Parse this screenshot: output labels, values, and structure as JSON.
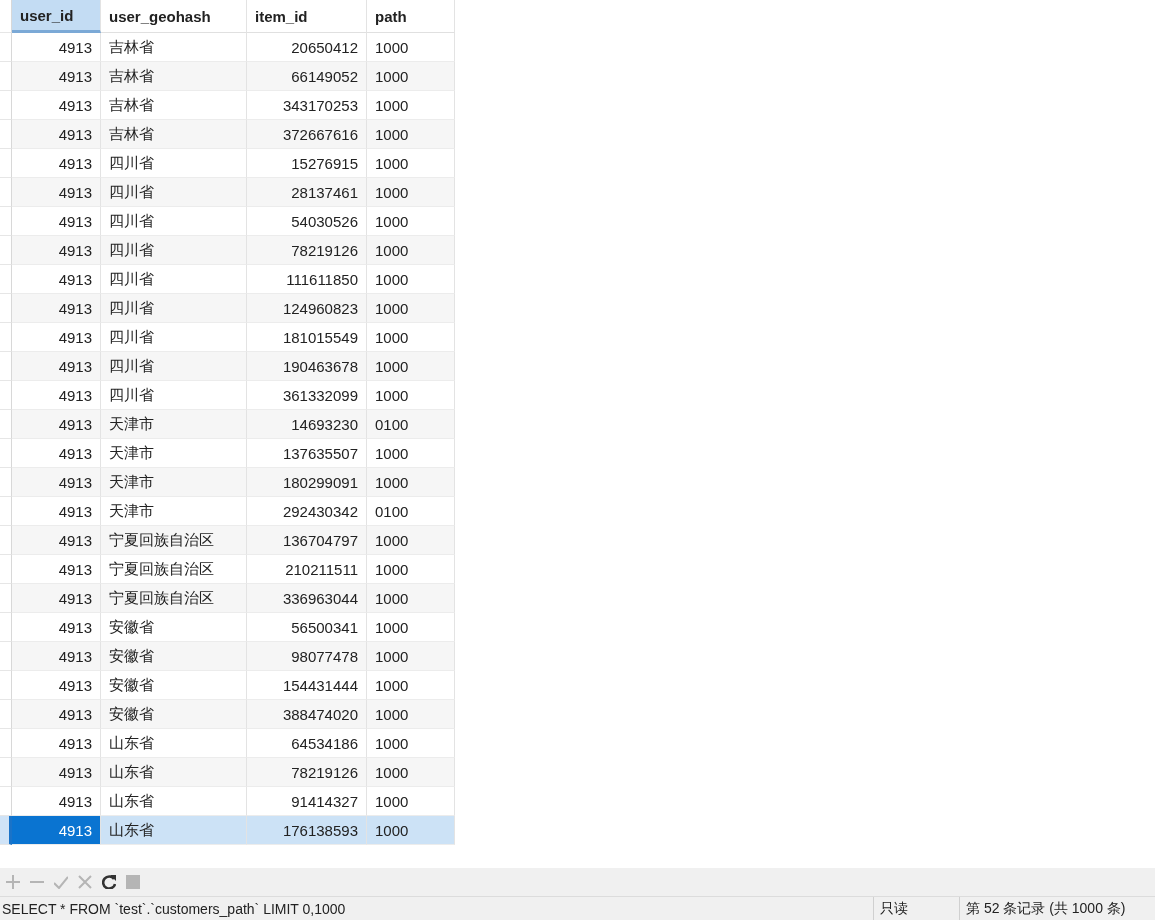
{
  "table": {
    "columns": [
      {
        "label": "user_id",
        "sorted": true
      },
      {
        "label": "user_geohash",
        "sorted": false
      },
      {
        "label": "item_id",
        "sorted": false
      },
      {
        "label": "path",
        "sorted": false
      }
    ],
    "rows": [
      {
        "cells": [
          "4913",
          "吉林省",
          "20650412",
          "1000"
        ],
        "selected": false
      },
      {
        "cells": [
          "4913",
          "吉林省",
          "66149052",
          "1000"
        ],
        "selected": false
      },
      {
        "cells": [
          "4913",
          "吉林省",
          "343170253",
          "1000"
        ],
        "selected": false
      },
      {
        "cells": [
          "4913",
          "吉林省",
          "372667616",
          "1000"
        ],
        "selected": false
      },
      {
        "cells": [
          "4913",
          "四川省",
          "15276915",
          "1000"
        ],
        "selected": false
      },
      {
        "cells": [
          "4913",
          "四川省",
          "28137461",
          "1000"
        ],
        "selected": false
      },
      {
        "cells": [
          "4913",
          "四川省",
          "54030526",
          "1000"
        ],
        "selected": false
      },
      {
        "cells": [
          "4913",
          "四川省",
          "78219126",
          "1000"
        ],
        "selected": false
      },
      {
        "cells": [
          "4913",
          "四川省",
          "111611850",
          "1000"
        ],
        "selected": false
      },
      {
        "cells": [
          "4913",
          "四川省",
          "124960823",
          "1000"
        ],
        "selected": false
      },
      {
        "cells": [
          "4913",
          "四川省",
          "181015549",
          "1000"
        ],
        "selected": false
      },
      {
        "cells": [
          "4913",
          "四川省",
          "190463678",
          "1000"
        ],
        "selected": false
      },
      {
        "cells": [
          "4913",
          "四川省",
          "361332099",
          "1000"
        ],
        "selected": false
      },
      {
        "cells": [
          "4913",
          "天津市",
          "14693230",
          "0100"
        ],
        "selected": false
      },
      {
        "cells": [
          "4913",
          "天津市",
          "137635507",
          "1000"
        ],
        "selected": false
      },
      {
        "cells": [
          "4913",
          "天津市",
          "180299091",
          "1000"
        ],
        "selected": false
      },
      {
        "cells": [
          "4913",
          "天津市",
          "292430342",
          "0100"
        ],
        "selected": false
      },
      {
        "cells": [
          "4913",
          "宁夏回族自治区",
          "136704797",
          "1000"
        ],
        "selected": false
      },
      {
        "cells": [
          "4913",
          "宁夏回族自治区",
          "210211511",
          "1000"
        ],
        "selected": false
      },
      {
        "cells": [
          "4913",
          "宁夏回族自治区",
          "336963044",
          "1000"
        ],
        "selected": false
      },
      {
        "cells": [
          "4913",
          "安徽省",
          "56500341",
          "1000"
        ],
        "selected": false
      },
      {
        "cells": [
          "4913",
          "安徽省",
          "98077478",
          "1000"
        ],
        "selected": false
      },
      {
        "cells": [
          "4913",
          "安徽省",
          "154431444",
          "1000"
        ],
        "selected": false
      },
      {
        "cells": [
          "4913",
          "安徽省",
          "388474020",
          "1000"
        ],
        "selected": false
      },
      {
        "cells": [
          "4913",
          "山东省",
          "64534186",
          "1000"
        ],
        "selected": false
      },
      {
        "cells": [
          "4913",
          "山东省",
          "78219126",
          "1000"
        ],
        "selected": false
      },
      {
        "cells": [
          "4913",
          "山东省",
          "91414327",
          "1000"
        ],
        "selected": false
      },
      {
        "cells": [
          "4913",
          "山东省",
          "176138593",
          "1000"
        ],
        "selected": true
      }
    ]
  },
  "toolbar": [
    {
      "kind": "add",
      "disabled": true
    },
    {
      "kind": "remove",
      "disabled": true
    },
    {
      "kind": "apply",
      "disabled": true
    },
    {
      "kind": "discard",
      "disabled": true
    },
    {
      "kind": "refresh",
      "disabled": false
    },
    {
      "kind": "stop",
      "disabled": true
    }
  ],
  "status_bar": {
    "query": "SELECT * FROM `test`.`customers_path` LIMIT 0,1000",
    "mode": "只读",
    "record": "第 52 条记录 (共 1000 条)"
  }
}
